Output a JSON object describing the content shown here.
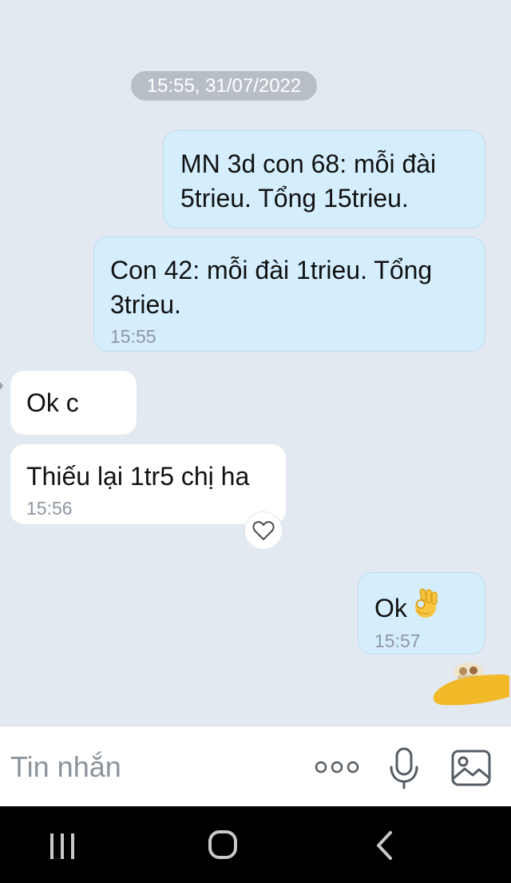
{
  "chat": {
    "date_divider": "15:55, 31/07/2022",
    "messages": [
      {
        "direction": "outgoing",
        "text": "MN 3d con 68: mỗi đài 5trieu. Tổng 15trieu.",
        "time": ""
      },
      {
        "direction": "outgoing",
        "text": "Con 42: mỗi đài 1trieu. Tổng 3trieu.",
        "time": "15:55"
      },
      {
        "direction": "incoming",
        "text": "Ok c",
        "time": ""
      },
      {
        "direction": "incoming",
        "text": "Thiếu lại 1tr5 chị ha",
        "time": "15:56"
      },
      {
        "direction": "outgoing",
        "text": "Ok",
        "emoji": "ok-hand",
        "time": "15:57"
      }
    ]
  },
  "composer": {
    "placeholder": "Tin nhắn",
    "more_icon": "more-icon",
    "mic_icon": "microphone-icon",
    "image_icon": "image-icon"
  },
  "navbar": {
    "recents_icon": "recents-icon",
    "home_icon": "home-icon",
    "back_icon": "back-icon"
  },
  "colors": {
    "chat_background": "#e2e9f1",
    "outgoing_bubble": "#d5eefe",
    "incoming_bubble": "#ffffff",
    "timestamp": "#8d97a2",
    "date_pill": "#b8bec6",
    "scribble": "#f2b928"
  }
}
